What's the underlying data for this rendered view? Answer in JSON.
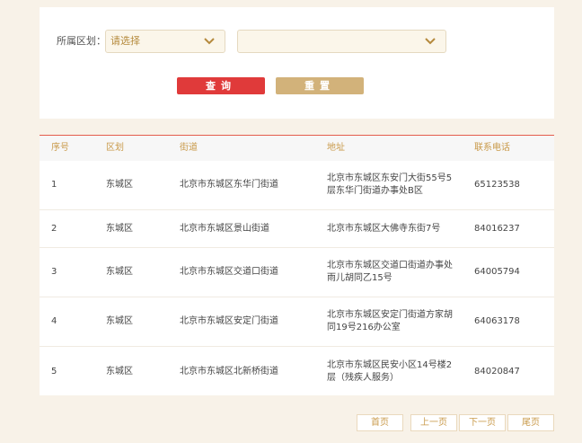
{
  "filter": {
    "label": "所属区划：",
    "district_select": {
      "value": "请选择"
    },
    "street_select": {
      "value": ""
    },
    "query_label": "查询",
    "reset_label": "重置"
  },
  "table": {
    "headers": [
      "序号",
      "区划",
      "街道",
      "地址",
      "联系电话"
    ],
    "rows": [
      [
        "1",
        "东城区",
        "北京市东城区东华门街道",
        "北京市东城区东安门大街55号5层东华门街道办事处B区",
        "65123538"
      ],
      [
        "2",
        "东城区",
        "北京市东城区景山街道",
        "北京市东城区大佛寺东街7号",
        "84016237"
      ],
      [
        "3",
        "东城区",
        "北京市东城区交道口街道",
        "北京市东城区交道口街道办事处雨儿胡同乙15号",
        "64005794"
      ],
      [
        "4",
        "东城区",
        "北京市东城区安定门街道",
        "北京市东城区安定门街道方家胡同19号216办公室",
        "64063178"
      ],
      [
        "5",
        "东城区",
        "北京市东城区北新桥街道",
        "北京市东城区民安小区14号楼2层（残疾人服务）",
        "84020847"
      ]
    ]
  },
  "pager": {
    "first": "首页",
    "prev": "上一页",
    "next": "下一页",
    "last": "尾页"
  },
  "colors": {
    "accent_red": "#e03a3a",
    "accent_gold": "#d2b27a",
    "background": "#f8f2e8"
  }
}
